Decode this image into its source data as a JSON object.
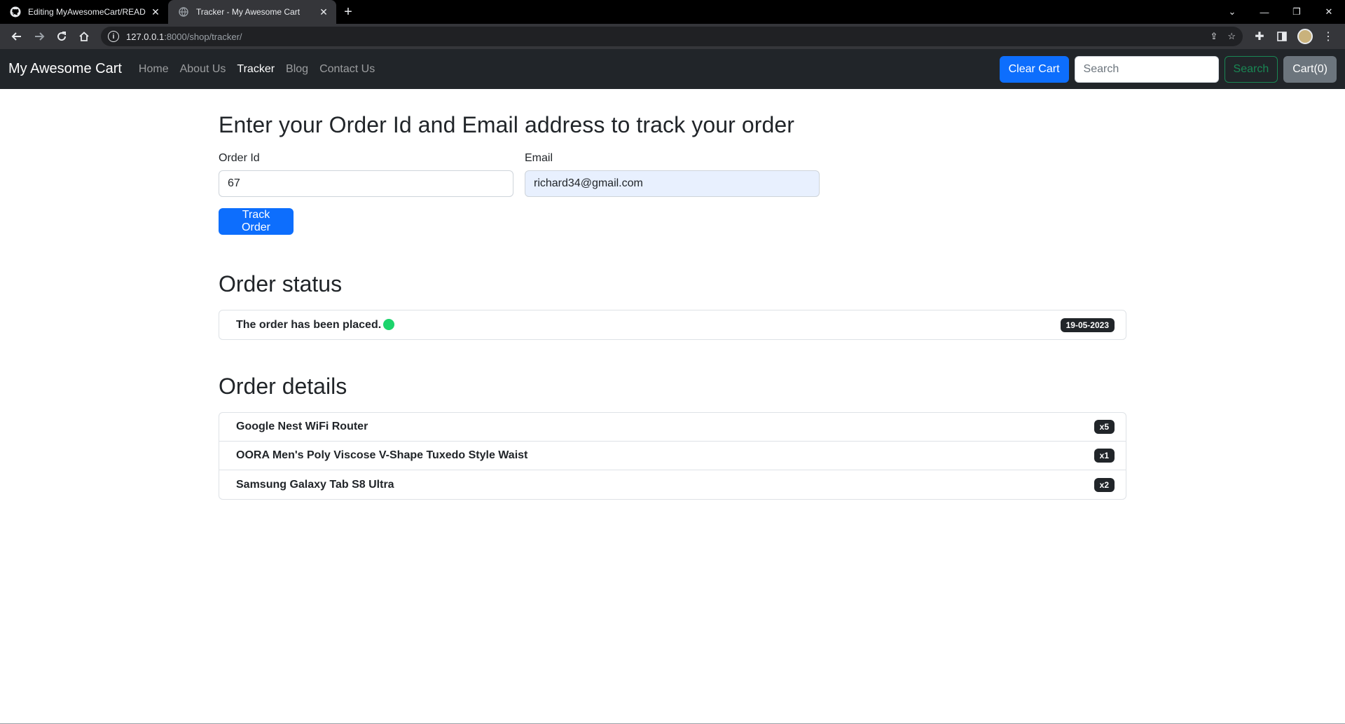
{
  "browser": {
    "tabs": [
      {
        "title": "Editing MyAwesomeCart/README",
        "favicon": "github-icon",
        "active": false
      },
      {
        "title": "Tracker - My Awesome Cart",
        "favicon": "globe-icon",
        "active": true
      }
    ],
    "new_tab": "+",
    "url_host": "127.0.0.1",
    "url_path": ":8000/shop/tracker/"
  },
  "navbar": {
    "brand": "My Awesome Cart",
    "links": [
      {
        "label": "Home",
        "active": false
      },
      {
        "label": "About Us",
        "active": false
      },
      {
        "label": "Tracker",
        "active": true
      },
      {
        "label": "Blog",
        "active": false
      },
      {
        "label": "Contact Us",
        "active": false
      }
    ],
    "clear_cart": "Clear Cart",
    "search_placeholder": "Search",
    "search_button": "Search",
    "cart_button": "Cart(0)"
  },
  "main": {
    "heading": "Enter your Order Id and Email address to track your order",
    "order_id_label": "Order Id",
    "order_id_value": "67",
    "email_label": "Email",
    "email_value": "richard34@gmail.com",
    "track_button": "Track Order",
    "status_heading": "Order status",
    "status": {
      "text": "The order has been placed.",
      "date": "19-05-2023",
      "indicator_color": "#1cd46c"
    },
    "details_heading": "Order details",
    "items": [
      {
        "name": "Google Nest WiFi Router",
        "qty": "x5"
      },
      {
        "name": "OORA Men's Poly Viscose V-Shape Tuxedo Style Waist",
        "qty": "x1"
      },
      {
        "name": "Samsung Galaxy Tab S8 Ultra",
        "qty": "x2"
      }
    ]
  },
  "colors": {
    "primary": "#0d6efd",
    "navbar_bg": "#212529",
    "success": "#198754",
    "secondary": "#6c757d"
  }
}
